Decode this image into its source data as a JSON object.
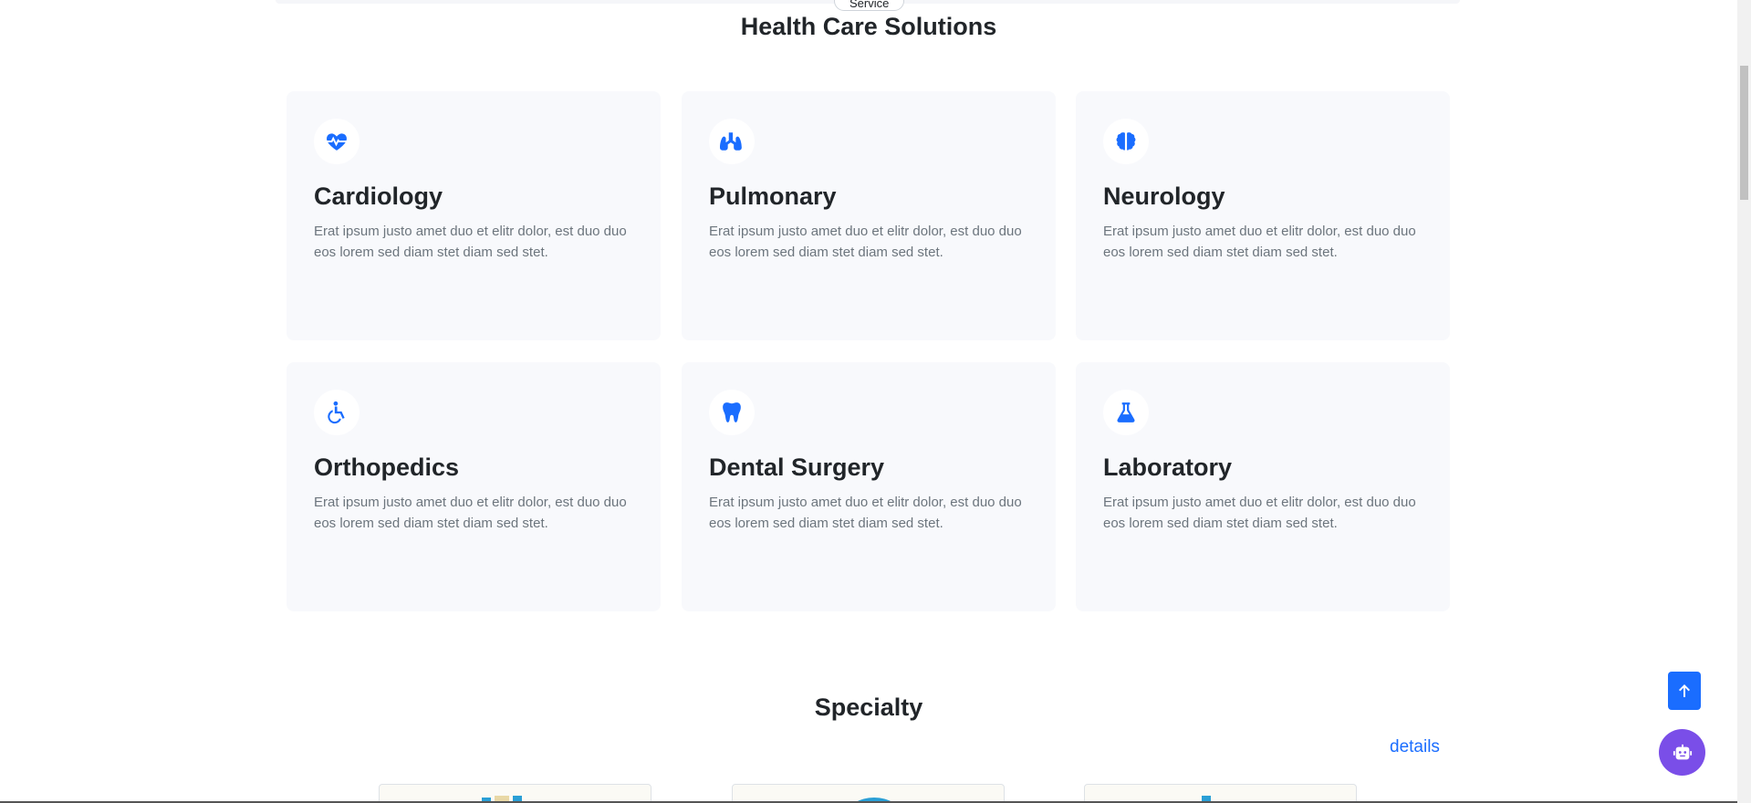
{
  "header": {
    "badge": "Service",
    "title": "Health Care Solutions"
  },
  "cards": [
    {
      "title": "Cardiology",
      "text": "Erat ipsum justo amet duo et elitr dolor, est duo duo eos lorem sed diam stet diam sed stet.",
      "icon": "heartbeat-icon"
    },
    {
      "title": "Pulmonary",
      "text": "Erat ipsum justo amet duo et elitr dolor, est duo duo eos lorem sed diam stet diam sed stet.",
      "icon": "lungs-icon"
    },
    {
      "title": "Neurology",
      "text": "Erat ipsum justo amet duo et elitr dolor, est duo duo eos lorem sed diam stet diam sed stet.",
      "icon": "brain-icon"
    },
    {
      "title": "Orthopedics",
      "text": "Erat ipsum justo amet duo et elitr dolor, est duo duo eos lorem sed diam stet diam sed stet.",
      "icon": "wheelchair-icon"
    },
    {
      "title": "Dental Surgery",
      "text": "Erat ipsum justo amet duo et elitr dolor, est duo duo eos lorem sed diam stet diam sed stet.",
      "icon": "tooth-icon"
    },
    {
      "title": "Laboratory",
      "text": "Erat ipsum justo amet duo et elitr dolor, est duo duo eos lorem sed diam stet diam sed stet.",
      "icon": "flask-icon"
    }
  ],
  "specialty": {
    "title": "Specialty",
    "details_label": "details"
  },
  "colors": {
    "accent": "#1a6dff",
    "chatbot": "#7a4ee8",
    "card_bg": "#f8f9fc"
  },
  "floating": {
    "back_to_top_icon": "arrow-up-icon",
    "chatbot_icon": "robot-icon"
  }
}
